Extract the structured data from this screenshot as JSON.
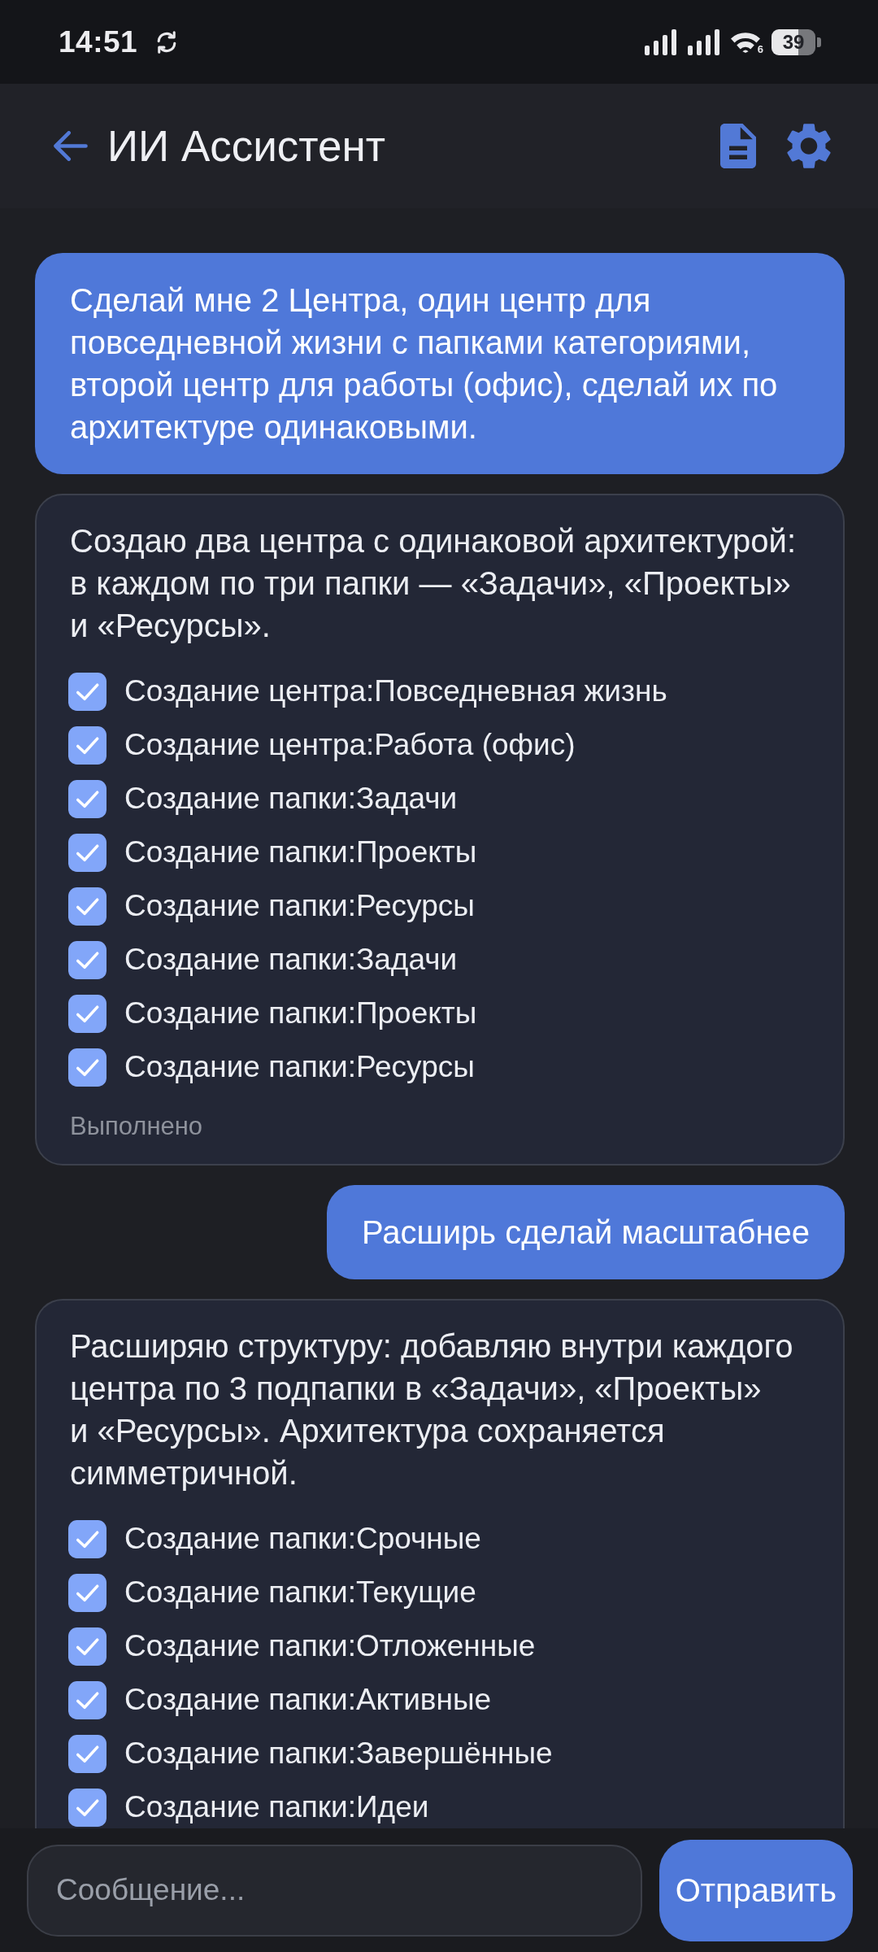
{
  "status_bar": {
    "time": "14:51",
    "wifi_badge": "6",
    "battery": "39"
  },
  "header": {
    "title": "ИИ Ассистент"
  },
  "messages": [
    {
      "kind": "user",
      "text": "Сделай мне 2 Центра, один центр для повседневной жизни с папками категориями, второй центр для работы (офис), сделай их по архитектуре одинаковыми."
    },
    {
      "kind": "assistant",
      "text": "Создаю два центра с одинаковой архитектурой: в каждом по три папки — «Задачи», «Проекты» и «Ресурсы».",
      "tasks": [
        {
          "label": "Создание центра:Повседневная жизнь",
          "checked": true
        },
        {
          "label": "Создание центра:Работа (офис)",
          "checked": true
        },
        {
          "label": "Создание папки:Задачи",
          "checked": true
        },
        {
          "label": "Создание папки:Проекты",
          "checked": true
        },
        {
          "label": "Создание папки:Ресурсы",
          "checked": true
        },
        {
          "label": "Создание папки:Задачи",
          "checked": true
        },
        {
          "label": "Создание папки:Проекты",
          "checked": true
        },
        {
          "label": "Создание папки:Ресурсы",
          "checked": true
        }
      ],
      "status": "Выполнено"
    },
    {
      "kind": "user",
      "text": "Расширь сделай масштабнее"
    },
    {
      "kind": "assistant",
      "text": "Расширяю структуру: добавляю внутри каждого центра по 3 подпапки в «Задачи», «Проекты» и «Ресурсы». Архитектура сохраняется симметричной.",
      "tasks": [
        {
          "label": "Создание папки:Срочные",
          "checked": true
        },
        {
          "label": "Создание папки:Текущие",
          "checked": true
        },
        {
          "label": "Создание папки:Отложенные",
          "checked": true
        },
        {
          "label": "Создание папки:Активные",
          "checked": true
        },
        {
          "label": "Создание папки:Завершённые",
          "checked": true
        },
        {
          "label": "Создание папки:Идеи",
          "checked": true
        }
      ]
    }
  ],
  "composer": {
    "placeholder": "Сообщение...",
    "send_button": "Отправить"
  }
}
